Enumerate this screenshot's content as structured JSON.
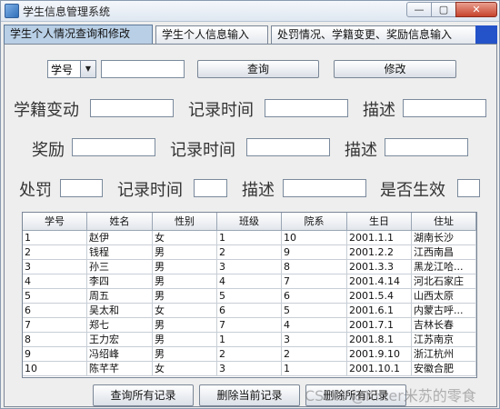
{
  "window": {
    "title": "学生信息管理系统",
    "min_label": "—",
    "max_label": "▢",
    "close_label": "✕"
  },
  "tabs": [
    {
      "label": "学生个人情况查询和修改"
    },
    {
      "label": "学生个人信息输入"
    },
    {
      "label": "处罚情况、学籍变更、奖励信息输入"
    }
  ],
  "search": {
    "field_select": "学号",
    "query_value": "",
    "query_button": "查询",
    "modify_button": "修改"
  },
  "change_row": {
    "label": "学籍变动",
    "time_label": "记录时间",
    "desc_label": "描述"
  },
  "reward_row": {
    "label": "奖励",
    "time_label": "记录时间",
    "desc_label": "描述"
  },
  "punish_row": {
    "label": "处罚",
    "time_label": "记录时间",
    "desc_label": "描述",
    "effective_label": "是否生效"
  },
  "table": {
    "columns": [
      "学号",
      "姓名",
      "性别",
      "班级",
      "院系",
      "生日",
      "住址"
    ],
    "rows": [
      [
        "1",
        "赵伊",
        "女",
        "1",
        "10",
        "2001.1.1",
        "湖南长沙"
      ],
      [
        "2",
        "钱程",
        "男",
        "2",
        "9",
        "2001.2.2",
        "江西南昌"
      ],
      [
        "3",
        "孙三",
        "男",
        "3",
        "8",
        "2001.3.3",
        "黑龙江哈..."
      ],
      [
        "4",
        "李四",
        "男",
        "4",
        "7",
        "2001.4.14",
        "河北石家庄"
      ],
      [
        "5",
        "周五",
        "男",
        "5",
        "6",
        "2001.5.4",
        "山西太原"
      ],
      [
        "6",
        "吴太和",
        "女",
        "6",
        "5",
        "2001.6.1",
        "内蒙古呼..."
      ],
      [
        "7",
        "郑七",
        "男",
        "7",
        "4",
        "2001.7.1",
        "吉林长春"
      ],
      [
        "8",
        "王力宏",
        "男",
        "1",
        "3",
        "2001.8.1",
        "江苏南京"
      ],
      [
        "9",
        "冯绍峰",
        "男",
        "2",
        "2",
        "2001.9.10",
        "浙江杭州"
      ],
      [
        "10",
        "陈芊芊",
        "女",
        "3",
        "1",
        "2001.10.1",
        "安徽合肥"
      ]
    ]
  },
  "actions": {
    "query_all": "查询所有记录",
    "delete_current": "删除当前记录",
    "delete_all": "删除所有记录"
  },
  "watermark": "CSDN @Kilter米苏的零食"
}
